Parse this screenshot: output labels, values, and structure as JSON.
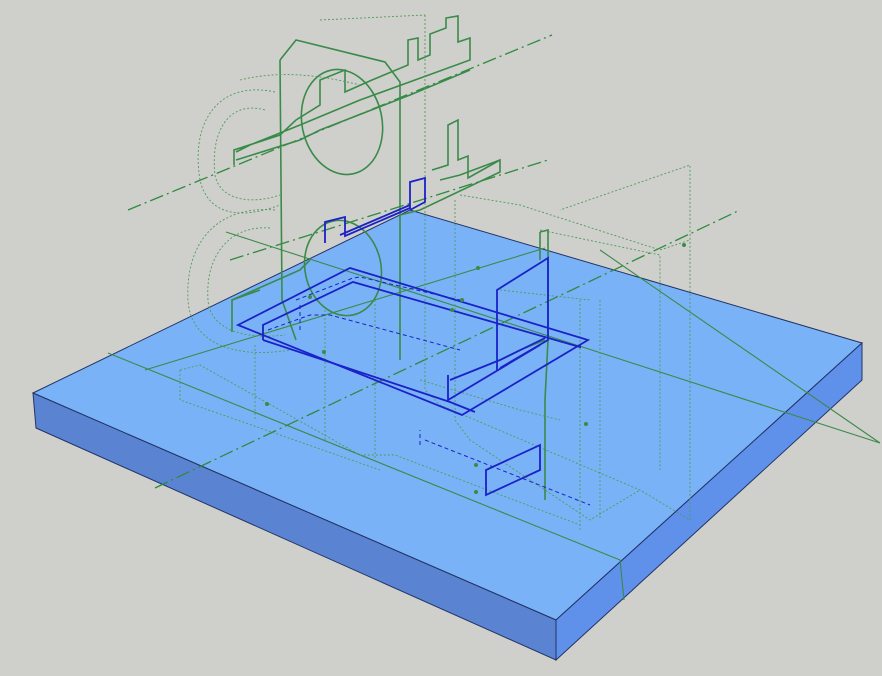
{
  "viewport": {
    "background": "#cfd0cb",
    "colors": {
      "slab_top": "#7ab2f8",
      "slab_front": "#5a84d2",
      "slab_right": "#5f90ea",
      "edge": "#223366",
      "green_lines": "#3a8a4a",
      "blue_lines": "#1a22c8"
    }
  }
}
